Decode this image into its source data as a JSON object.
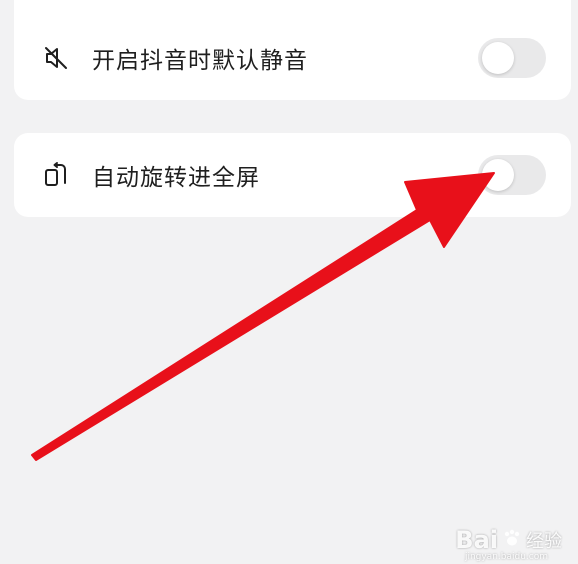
{
  "settings": {
    "items": [
      {
        "label": "开启抖音时默认静音",
        "icon": "speaker-mute-icon",
        "enabled": false
      },
      {
        "label": "自动旋转进全屏",
        "icon": "rotate-screen-icon",
        "enabled": false
      }
    ]
  },
  "annotation": {
    "arrow_color": "#e8101a"
  },
  "watermark": {
    "brand": "Bai",
    "text": "经验",
    "sub": "jingyan.baidu.com"
  }
}
